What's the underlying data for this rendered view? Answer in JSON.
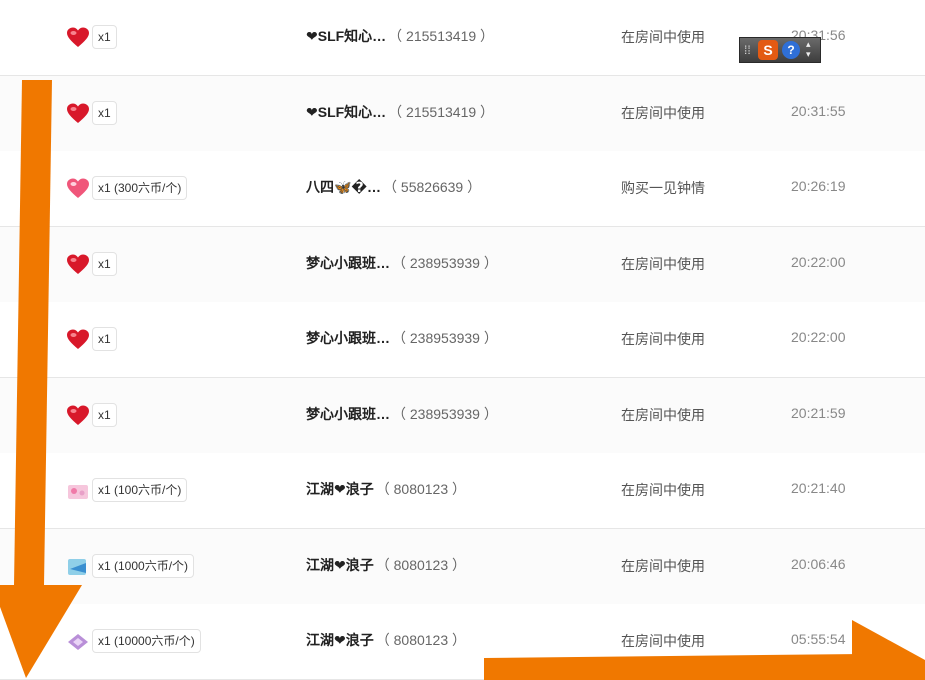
{
  "records": [
    {
      "icon": "heart",
      "qty": "x1",
      "name": "❤SLF知心…",
      "uid": "（ 215513419 ）",
      "usage": "在房间中使用",
      "time": "20:31:56"
    },
    {
      "icon": "heart",
      "qty": "x1",
      "name": "❤SLF知心…",
      "uid": "（ 215513419 ）",
      "usage": "在房间中使用",
      "time": "20:31:55"
    },
    {
      "icon": "heart-pink",
      "qty": "x1 (300六币/个)",
      "name": "八四🦋�…",
      "uid": "（ 55826639 ）",
      "usage": "购买一见钟情",
      "time": "20:26:19"
    },
    {
      "icon": "heart",
      "qty": "x1",
      "name": "梦心小跟班…",
      "uid": "（ 238953939 ）",
      "usage": "在房间中使用",
      "time": "20:22:00"
    },
    {
      "icon": "heart",
      "qty": "x1",
      "name": "梦心小跟班…",
      "uid": "（ 238953939 ）",
      "usage": "在房间中使用",
      "time": "20:22:00"
    },
    {
      "icon": "heart",
      "qty": "x1",
      "name": "梦心小跟班…",
      "uid": "（ 238953939 ）",
      "usage": "在房间中使用",
      "time": "20:21:59"
    },
    {
      "icon": "gift-pink",
      "qty": "x1 (100六币/个)",
      "name": "江湖❤浪子",
      "uid": "（ 8080123 ）",
      "usage": "在房间中使用",
      "time": "20:21:40"
    },
    {
      "icon": "gift-blue",
      "qty": "x1 (1000六币/个)",
      "name": "江湖❤浪子",
      "uid": "（ 8080123 ）",
      "usage": "在房间中使用",
      "time": "20:06:46"
    },
    {
      "icon": "gift-purple",
      "qty": "x1 (10000六币/个)",
      "name": "江湖❤浪子",
      "uid": "（ 8080123 ）",
      "usage": "在房间中使用",
      "time": "05:55:54"
    }
  ],
  "ime_toolbar": {
    "logo": "S",
    "help": "?"
  },
  "colors": {
    "accent_orange": "#f07800",
    "heart_red": "#d8182a",
    "heart_pink": "#f0567a",
    "row_border": "#e6e6e6"
  }
}
